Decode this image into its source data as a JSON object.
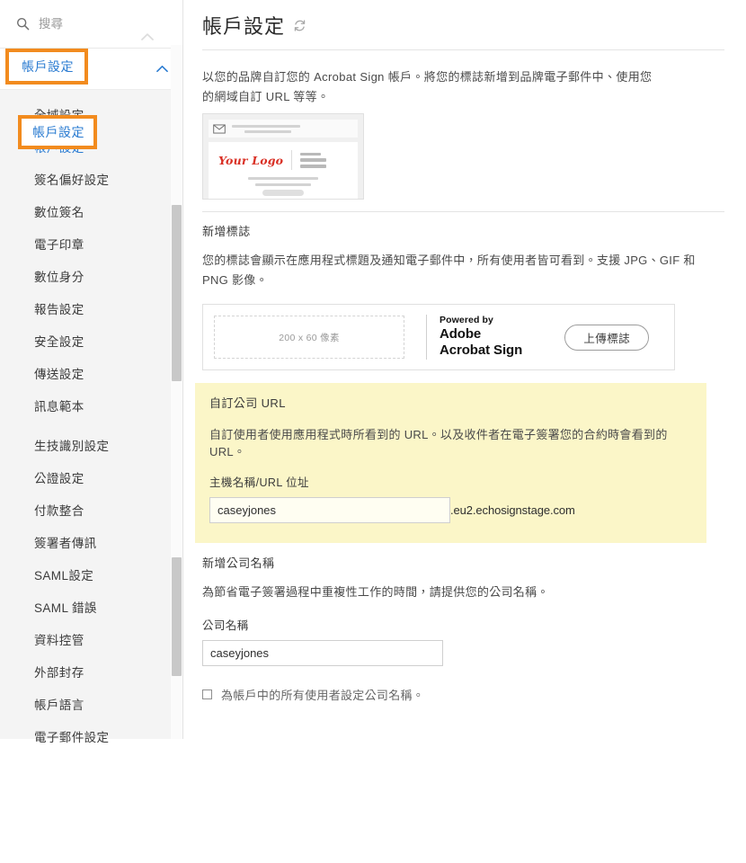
{
  "sidebar": {
    "search": {
      "placeholder": "搜尋",
      "value": "",
      "icon": "search-icon"
    },
    "accordion": {
      "label": "帳戶設定",
      "chevron": "chevron-up-icon",
      "expanded": true
    },
    "items": [
      {
        "label": "全域設定",
        "active": false
      },
      {
        "label": "帳戶設定",
        "active": true
      },
      {
        "label": "簽名偏好設定",
        "active": false
      },
      {
        "label": "數位簽名",
        "active": false
      },
      {
        "label": "電子印章",
        "active": false
      },
      {
        "label": "數位身分",
        "active": false
      },
      {
        "label": "報告設定",
        "active": false
      },
      {
        "label": "安全設定",
        "active": false
      },
      {
        "label": "傳送設定",
        "active": false
      },
      {
        "label": "訊息範本",
        "active": false
      },
      {
        "label": "生技識別設定",
        "active": false
      },
      {
        "label": "公證設定",
        "active": false
      },
      {
        "label": "付款整合",
        "active": false
      },
      {
        "label": "簽署者傳訊",
        "active": false
      },
      {
        "label": "SAML設定",
        "active": false
      },
      {
        "label": "SAML 錯誤",
        "active": false
      },
      {
        "label": "資料控管",
        "active": false
      },
      {
        "label": "外部封存",
        "active": false
      },
      {
        "label": "帳戶語言",
        "active": false
      },
      {
        "label": "電子郵件設定",
        "active": false
      }
    ],
    "highlights": {
      "accordion_label": "帳戶設定",
      "item_label": "帳戶設定",
      "color": "#f28b1e"
    }
  },
  "header": {
    "title": "帳戶設定",
    "refresh_icon": "refresh-icon"
  },
  "intro": {
    "text": "以您的品牌自訂您的 Acrobat Sign 帳戶。將您的標誌新增到品牌電子郵件中、使用您的網域自訂 URL 等等。"
  },
  "email_preview": {
    "logo_text": "Your Logo",
    "logo_color": "#d93025",
    "envelope_icon": "envelope-icon"
  },
  "logo_section": {
    "title": "新增標誌",
    "description": "您的標誌會顯示在應用程式標題及通知電子郵件中，所有使用者皆可看到。支援 JPG、GIF 和 PNG 影像。",
    "dropzone_text": "200 x 60 像素",
    "powered_by": "Powered by",
    "brand_line1": "Adobe",
    "brand_line2": "Acrobat Sign",
    "upload_button": "上傳標誌"
  },
  "url_section": {
    "highlight_color": "#fbf6c8",
    "title": "自訂公司 URL",
    "description": "自訂使用者使用應用程式時所看到的 URL。以及收件者在電子簽署您的合約時會看到的 URL。",
    "field_label": "主機名稱/URL 位址",
    "input_value": "caseyjones",
    "input_placeholder": "",
    "suffix": ".eu2.echosignstage.com"
  },
  "company_section": {
    "title": "新增公司名稱",
    "description": "為節省電子簽署過程中重複性工作的時間，請提供您的公司名稱。",
    "field_label": "公司名稱",
    "input_value": "caseyjones",
    "input_placeholder": "",
    "checkbox_label": "為帳戶中的所有使用者設定公司名稱。",
    "checkbox_checked": false
  }
}
